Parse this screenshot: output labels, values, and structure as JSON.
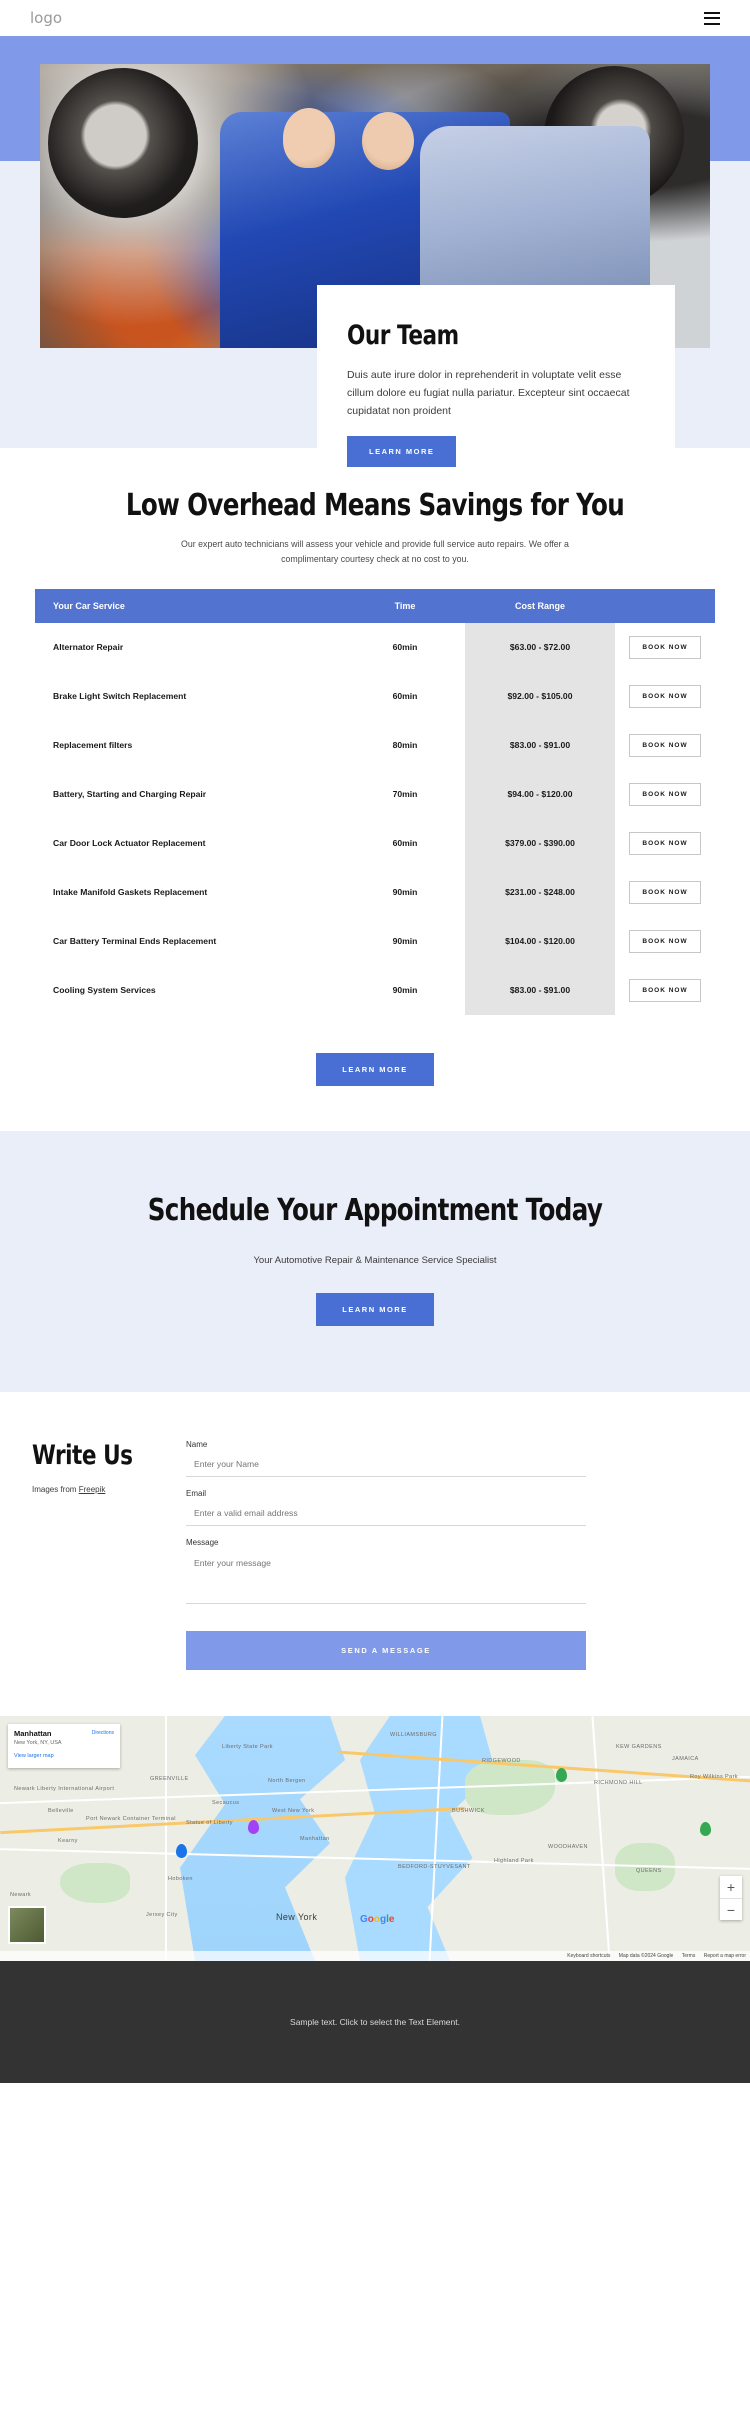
{
  "header": {
    "logo": "logo",
    "menu_icon": "hamburger-icon"
  },
  "hero": {
    "card": {
      "title": "Our Team",
      "text": "Duis aute irure dolor in reprehenderit in voluptate velit esse cillum dolore eu fugiat nulla pariatur. Excepteur sint occaecat cupidatat non proident",
      "button": "LEARN MORE"
    }
  },
  "pricing": {
    "title": "Low Overhead Means Savings for You",
    "subtitle": "Our expert auto technicians will assess your vehicle and provide full service auto repairs. We offer a complimentary courtesy check at no cost to you.",
    "columns": [
      "Your Car Service",
      "Time",
      "Cost Range",
      ""
    ],
    "rows": [
      {
        "service": "Alternator Repair",
        "time": "60min",
        "cost": "$63.00 - $72.00",
        "action": "BOOK NOW"
      },
      {
        "service": "Brake Light Switch Replacement",
        "time": "60min",
        "cost": "$92.00 - $105.00",
        "action": "BOOK NOW"
      },
      {
        "service": "Replacement filters",
        "time": "80min",
        "cost": "$83.00 - $91.00",
        "action": "BOOK NOW"
      },
      {
        "service": "Battery, Starting and Charging Repair",
        "time": "70min",
        "cost": "$94.00 - $120.00",
        "action": "BOOK NOW"
      },
      {
        "service": "Car Door Lock Actuator Replacement",
        "time": "60min",
        "cost": "$379.00 - $390.00",
        "action": "BOOK NOW"
      },
      {
        "service": "Intake Manifold Gaskets Replacement",
        "time": "90min",
        "cost": "$231.00 - $248.00",
        "action": "BOOK NOW"
      },
      {
        "service": "Car Battery Terminal Ends Replacement",
        "time": "90min",
        "cost": "$104.00 - $120.00",
        "action": "BOOK NOW"
      },
      {
        "service": "Cooling System Services",
        "time": "90min",
        "cost": "$83.00 - $91.00",
        "action": "BOOK NOW"
      }
    ],
    "cta": "LEARN MORE"
  },
  "appointment": {
    "title": "Schedule Your Appointment Today",
    "subtitle": "Your Automotive Repair & Maintenance Service Specialist",
    "button": "LEARN MORE"
  },
  "writeus": {
    "title": "Write Us",
    "credit_prefix": "Images from ",
    "credit_link": "Freepik",
    "fields": {
      "name_label": "Name",
      "name_placeholder": "Enter your Name",
      "email_label": "Email",
      "email_placeholder": "Enter a valid email address",
      "message_label": "Message",
      "message_placeholder": "Enter your message"
    },
    "submit": "SEND A MESSAGE"
  },
  "map": {
    "card": {
      "title": "Manhattan",
      "subtitle": "New York, NY, USA",
      "link": "View larger map",
      "directions": "Directions"
    },
    "zoom_in": "+",
    "zoom_out": "−",
    "google": {
      "g": "G",
      "o1": "o",
      "o2": "o",
      "g2": "g",
      "l": "l",
      "e": "e"
    },
    "attribution": {
      "shortcuts": "Keyboard shortcuts",
      "mapdata": "Map data ©2024 Google",
      "terms": "Terms",
      "report": "Report a map error"
    },
    "labels": [
      "Newark Liberty International Airport",
      "Port Newark Container Terminal",
      "Liberty State Park",
      "Statue of Liberty",
      "GREENVILLE",
      "WILLIAMSBURG",
      "RIDGEWOOD",
      "BUSHWICK",
      "KEW GARDENS",
      "RICHMOND HILL",
      "JAMAICA",
      "BEDFORD-STUYVESANT",
      "WOODHAVEN",
      "Highland Park",
      "Jersey City",
      "Hoboken",
      "Newark",
      "New York",
      "Manhattan",
      "QUEENS",
      "North Bergen",
      "West New York",
      "Secaucus",
      "Kearny",
      "Belleville",
      "Roy Wilkins Park"
    ]
  },
  "footer": {
    "text": "Sample text. Click to select the Text Element."
  },
  "colors": {
    "accent": "#5273d0",
    "accent_soft": "#8099e8",
    "section_bg": "#eaeef9",
    "cost_col": "#e4e4e4",
    "footer_bg": "#333333"
  }
}
